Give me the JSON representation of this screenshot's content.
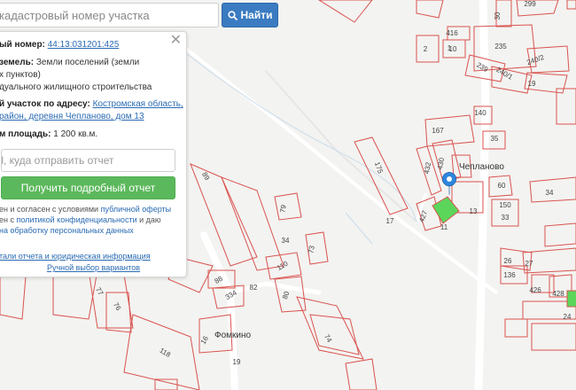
{
  "search": {
    "placeholder": "кадастровый номер участка",
    "button_label": "Найти",
    "button_icon": "search-icon"
  },
  "panel": {
    "cadastral_label": "ый номер:",
    "cadastral_value": "44:13:031201:425",
    "land_category_label": "земель:",
    "land_category_value_1": "Земли поселений (земли",
    "land_category_value_2": "х пунктов)",
    "permitted_use": "дуального жилищного строительства",
    "address_label": "й участок по адресу:",
    "address_value_1": "Костромская область,",
    "address_value_2": "район, деревня Чепланово, дом 13",
    "area_label": "м площадь:",
    "area_value": "1 200 кв.м.",
    "email_placeholder": "ail, куда отправить отчет",
    "report_button_label": "Получить подробный отчет",
    "consent": {
      "line1_prefix": "ен и согласен с условиями ",
      "offer_link": "публичной оферты",
      "line2_prefix": "ен с ",
      "privacy_link": "политикой конфиденциальности",
      "line2_suffix": " и даю",
      "data_link": "на обработку персональных данных"
    },
    "details_link": "тали отчета и юридическая информация",
    "manual_select_link": "Ручной выбор вариантов"
  },
  "map": {
    "places": [
      "Чепланово",
      "Фомкино"
    ],
    "plot_labels": [
      "299",
      "30",
      "416",
      "1",
      "10",
      "235",
      "2",
      "239",
      "240/2",
      "240/1",
      "19",
      "140",
      "167",
      "35",
      "175",
      "430",
      "432",
      "60",
      "34",
      "150",
      "33",
      "427",
      "13",
      "11",
      "17",
      "79",
      "89",
      "34",
      "73",
      "110",
      "88",
      "334",
      "82",
      "80",
      "74",
      "16",
      "118",
      "76",
      "77",
      "19",
      "26",
      "27",
      "136",
      "426",
      "428",
      "24"
    ],
    "colors": {
      "background": "#f3f3f1",
      "parcel_stroke": "#d9534f",
      "road": "#ffffff",
      "selected_parcel": "#5bd65b",
      "marker": "#2e86de"
    }
  }
}
